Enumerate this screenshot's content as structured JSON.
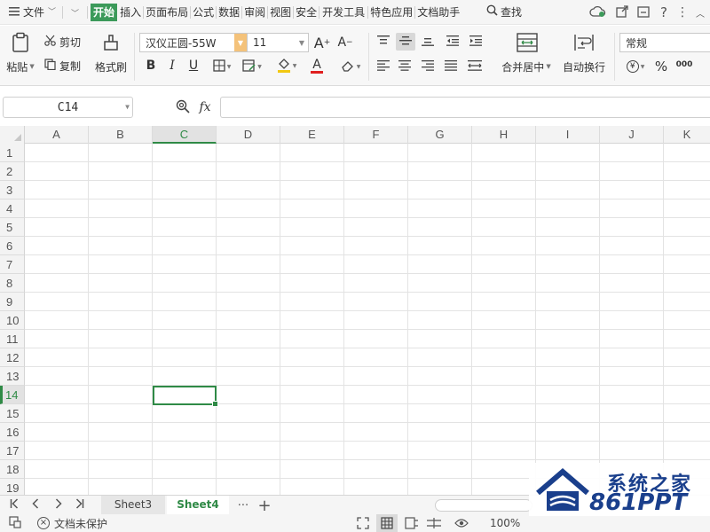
{
  "menubar": {
    "file": "文件",
    "tabs": [
      "开始",
      "插入",
      "页面布局",
      "公式",
      "数据",
      "审阅",
      "视图",
      "安全",
      "开发工具",
      "特色应用",
      "文档助手"
    ],
    "active_tab": "开始",
    "search": "查找"
  },
  "ribbon": {
    "paste": "粘贴",
    "cut": "剪切",
    "copy": "复制",
    "format_painter": "格式刷",
    "font_name": "汉仪正圆-55W",
    "font_size": "11",
    "bold": "B",
    "italic": "I",
    "underline": "U",
    "font_color_letter": "A",
    "font_grow": "A",
    "font_shrink": "A",
    "merge_center": "合并居中",
    "wrap_text": "自动换行",
    "number_format": "常规",
    "currency": "¥",
    "percent": "%",
    "thousands": "000"
  },
  "formula_bar": {
    "cell_ref": "C14",
    "fx": "fx",
    "value": ""
  },
  "grid": {
    "columns": [
      "A",
      "B",
      "C",
      "D",
      "E",
      "F",
      "G",
      "H",
      "I",
      "J",
      "K"
    ],
    "rows": [
      "1",
      "2",
      "3",
      "4",
      "5",
      "6",
      "7",
      "8",
      "9",
      "10",
      "11",
      "12",
      "13",
      "14",
      "15",
      "16",
      "17",
      "18",
      "19"
    ],
    "active_column": "C",
    "active_row": "14"
  },
  "sheets": {
    "tabs": [
      "Sheet3",
      "Sheet4"
    ],
    "active": "Sheet4",
    "more": "···",
    "add": "+"
  },
  "status": {
    "protection": "文档未保护",
    "zoom": "100%"
  },
  "watermark": {
    "line1": "系统之家",
    "line2": "861PPT"
  },
  "colors": {
    "accent": "#2f8a46",
    "active_tab_bg": "#3c9a5a",
    "watermark": "#1a3f8c"
  }
}
